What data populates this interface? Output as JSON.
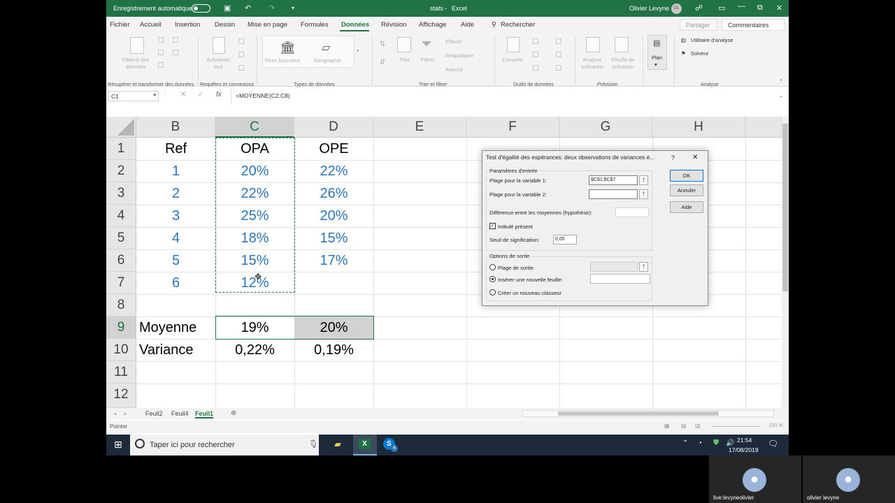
{
  "titlebar": {
    "autosave_label": "Enregistrement automatique",
    "filename": "stats",
    "separator": "-",
    "app": "Excel",
    "user": "Olivier Levyne",
    "initials": "OL"
  },
  "menu": {
    "items": [
      "Fichier",
      "Accueil",
      "Insertion",
      "Dessin",
      "Mise en page",
      "Formules",
      "Données",
      "Révision",
      "Affichage",
      "Aide"
    ],
    "active": "Données",
    "search": "Rechercher",
    "share": "Partager",
    "comments": "Commentaires"
  },
  "ribbon": {
    "get_data": "Obtenir des données",
    "refresh": "Actualiser tout",
    "stocks": "Titres boursiers",
    "geography": "Géographie",
    "sort": "Trier",
    "filter": "Filtrer",
    "clear": "Effacer",
    "reapply": "Réappliquer",
    "advanced": "Avancé",
    "convert": "Convertir",
    "scenario": "Analyse scénarios",
    "forecast": "Feuille de prévision",
    "plan": "Plan",
    "analysis_tool": "Utilitaire d'analyse",
    "solver": "Solveur",
    "groups": {
      "get_transform": "Récupérer et transformer des données",
      "queries": "Requêtes et connexions",
      "data_types": "Types de données",
      "sort_filter": "Trier et filtrer",
      "data_tools": "Outils de données",
      "forecast": "Prévision",
      "analysis": "Analyse"
    }
  },
  "formula_bar": {
    "name_box": "C1",
    "formula": "=MOYENNE(C2:C8)"
  },
  "sheet": {
    "columns": [
      "B",
      "C",
      "D",
      "E",
      "F",
      "G",
      "H"
    ],
    "rows": [
      "1",
      "2",
      "3",
      "4",
      "5",
      "6",
      "7",
      "8",
      "9",
      "10",
      "11",
      "12"
    ],
    "headers": {
      "B": "Ref",
      "C": "OPA",
      "D": "OPE"
    },
    "refs": [
      "1",
      "2",
      "3",
      "4",
      "5",
      "6"
    ],
    "opa": [
      "20%",
      "22%",
      "25%",
      "18%",
      "15%",
      "12%"
    ],
    "ope": [
      "22%",
      "26%",
      "20%",
      "15%",
      "17%"
    ],
    "mean_label": "Moyenne",
    "mean_opa": "19%",
    "mean_ope": "20%",
    "var_label": "Variance",
    "var_opa": "0,22%",
    "var_ope": "0,19%"
  },
  "tabs": [
    "Feuil2",
    "Feuil4",
    "Feuil1"
  ],
  "active_tab": "Feuil1",
  "status": {
    "mode": "Pointer",
    "zoom": "233 %"
  },
  "dialog": {
    "title": "Test d'égalité des espérances: deux observations de variances é...",
    "help_char": "?",
    "close_char": "✕",
    "input_params": "Paramètres d'entrée",
    "range1_label": "Plage pour la variable 1:",
    "range1_value": "$C$1:$C$7",
    "range2_label": "Plage pour la variable 2:",
    "range2_value": "",
    "diff_label": "Différence entre les moyennes (hypothèse):",
    "labels_label": "Intitulé présent",
    "labels_checked": true,
    "alpha_label": "Seuil de signification:",
    "alpha_value": "0,05",
    "output_options": "Options de sortie",
    "out_range": "Plage de sortie:",
    "new_sheet": "Insérer une nouvelle feuille:",
    "new_book": "Créer un nouveau classeur",
    "ok": "OK",
    "cancel": "Annuler",
    "help": "Aide"
  },
  "taskbar": {
    "search": "Taper ici pour rechercher",
    "time": "21:54",
    "date": "17/08/2019",
    "skype_badge": "4"
  },
  "participants": [
    {
      "name": "live:levyneolivier"
    },
    {
      "name": "olivier levyne"
    }
  ]
}
